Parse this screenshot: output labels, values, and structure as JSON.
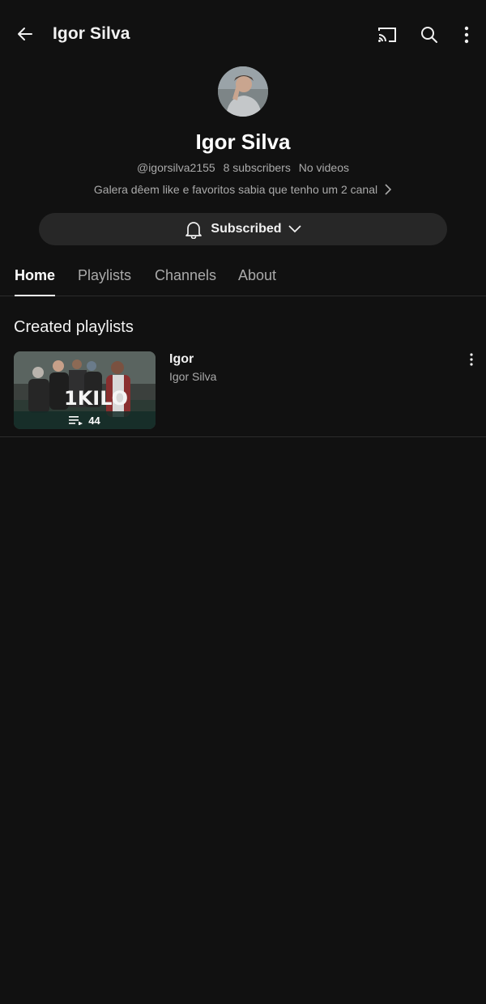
{
  "header": {
    "title": "Igor Silva",
    "icons": [
      "back-arrow-icon",
      "cast-icon",
      "search-icon",
      "more-vertical-icon"
    ]
  },
  "channel": {
    "name": "Igor Silva",
    "handle": "@igorsilva2155",
    "subscribers": "8 subscribers",
    "videos": "No videos",
    "description": "Galera dêem like e favoritos sabia que tenho um 2 canal",
    "subscribe_label": "Subscribed"
  },
  "tabs": [
    {
      "label": "Home",
      "active": true
    },
    {
      "label": "Playlists",
      "active": false
    },
    {
      "label": "Channels",
      "active": false
    },
    {
      "label": "About",
      "active": false
    }
  ],
  "section": {
    "title": "Created playlists"
  },
  "playlists": [
    {
      "title": "Igor",
      "owner": "Igor Silva",
      "video_count": "44",
      "thumbnail_logo": "1KILO"
    }
  ],
  "colors": {
    "background": "#111111",
    "button_bg": "#272727",
    "text_primary": "#f1f1f1",
    "text_secondary": "#aaaaaa",
    "divider": "#2c2c2c"
  }
}
